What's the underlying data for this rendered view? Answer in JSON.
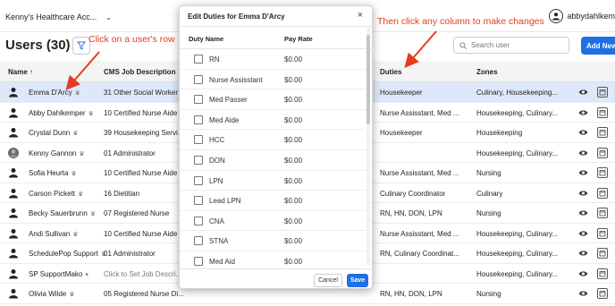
{
  "topbar": {
    "org_name": "Kenny's Healthcare Acc...",
    "username": "abbydahlkem"
  },
  "page": {
    "title": "Users (30)",
    "search_placeholder": "Search user",
    "add_button": "Add New"
  },
  "annotations": {
    "left": "Click on a user's row",
    "right": "Then click any column to make changes",
    "color": "#e53b1f"
  },
  "table": {
    "columns": {
      "name": "Name ↑",
      "job": "CMS Job Description",
      "duties": "Duties",
      "zones": "Zones"
    },
    "rows": [
      {
        "name": "Emma D'Arcy",
        "crown": true,
        "job": "31 Other Social Worker",
        "duties": "Housekeeper",
        "zones": "Culinary, Housekeeping...",
        "selected": true
      },
      {
        "name": "Abby Dahlkemper",
        "crown": true,
        "job": "10 Certified Nurse Aide",
        "duties": "Nurse Assisstant, Med ...",
        "zones": "Housekeeping, Culinary..."
      },
      {
        "name": "Crystal Dunn",
        "crown": true,
        "job": "39 Housekeeping Servi...",
        "duties": "Housekeeper",
        "zones": "Housekeeping"
      },
      {
        "name": "Kenny Gannon",
        "crown": true,
        "job": "01 Administrator",
        "duties": "",
        "zones": "Housekeeping, Culinary...",
        "photo": true
      },
      {
        "name": "Sofia Heurta",
        "crown": true,
        "job": "10 Certified Nurse Aide",
        "duties": "Nurse Assisstant, Med ...",
        "zones": "Nursing"
      },
      {
        "name": "Carson Pickett",
        "crown": true,
        "job": "16 Dietitian",
        "duties": "Culinary Coordinator",
        "zones": "Culinary"
      },
      {
        "name": "Becky Sauerbrunn",
        "crown": true,
        "job": "07 Registered Nurse",
        "duties": "RN, HN, DON, LPN",
        "zones": "Nursing"
      },
      {
        "name": "Andi Sullivan",
        "crown": true,
        "job": "10 Certified Nurse Aide",
        "duties": "Nurse Assisstant, Med ...",
        "zones": "Housekeeping, Culinary..."
      },
      {
        "name": "SchedulePop Support",
        "crown": true,
        "job": "01 Administrator",
        "duties": "RN, Culinary Coordinat...",
        "zones": "Housekeeping, Culinary..."
      },
      {
        "name": "SP SupportMako",
        "crown": false,
        "dropdown": true,
        "job": "Click to Set Job Descri...",
        "job_placeholder": true,
        "duties": "",
        "zones": "Housekeeping, Culinary..."
      },
      {
        "name": "Olivia Wilde",
        "crown": true,
        "job": "05 Registered Nurse Di...",
        "duties": "RN, HN, DON, LPN",
        "zones": "Nursing"
      }
    ]
  },
  "modal": {
    "title": "Edit Duties for Emma D'Arcy",
    "close": "×",
    "col_duty": "Duty Name",
    "col_pay": "Pay Rate",
    "duties": [
      {
        "name": "RN",
        "pay": "$0.00"
      },
      {
        "name": "Nurse Assisstant",
        "pay": "$0.00"
      },
      {
        "name": "Med Passer",
        "pay": "$0.00"
      },
      {
        "name": "Med Aide",
        "pay": "$0.00"
      },
      {
        "name": "HCC",
        "pay": "$0.00"
      },
      {
        "name": "DON",
        "pay": "$0.00"
      },
      {
        "name": "LPN",
        "pay": "$0.00"
      },
      {
        "name": "Lead LPN",
        "pay": "$0.00"
      },
      {
        "name": "CNA",
        "pay": "$0.00"
      },
      {
        "name": "STNA",
        "pay": "$0.00"
      },
      {
        "name": "Med Aid",
        "pay": "$0.00"
      }
    ],
    "cancel": "Cancel",
    "save": "Save"
  },
  "colors": {
    "accent": "#1f6fe5",
    "selected_row": "#dde9fb"
  }
}
